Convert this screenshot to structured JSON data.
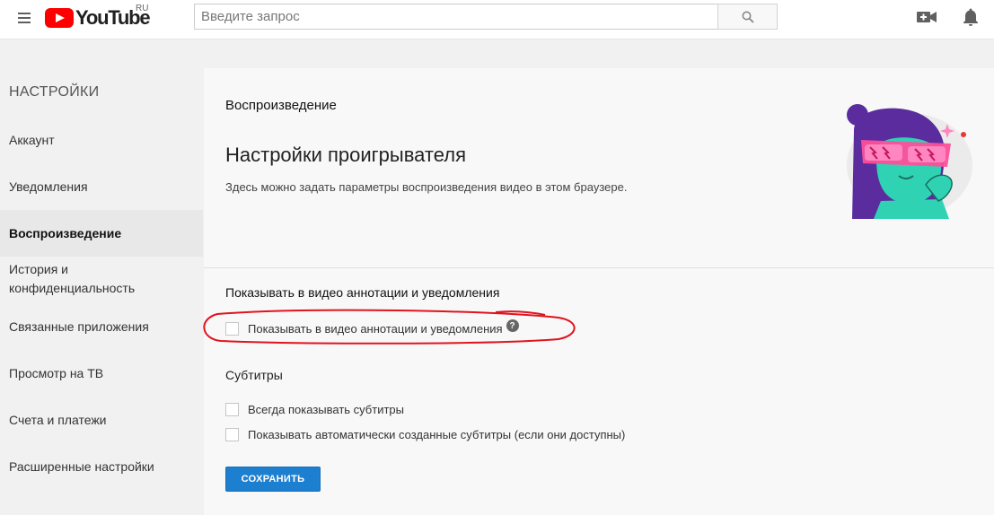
{
  "header": {
    "logo_text": "YouTube",
    "logo_region": "RU",
    "search_placeholder": "Введите запрос"
  },
  "sidebar": {
    "title": "НАСТРОЙКИ",
    "items": [
      {
        "label": "Аккаунт"
      },
      {
        "label": "Уведомления"
      },
      {
        "label": "Воспроизведение"
      },
      {
        "label": "История и конфиденциальность"
      },
      {
        "label": "Связанные приложения"
      },
      {
        "label": "Просмотр на ТВ"
      },
      {
        "label": "Счета и платежи"
      },
      {
        "label": "Расширенные настройки"
      }
    ]
  },
  "main": {
    "section_title": "Воспроизведение",
    "heading": "Настройки проигрывателя",
    "description": "Здесь можно задать параметры воспроизведения видео в этом браузере.",
    "annotations": {
      "heading": "Показывать в видео аннотации и уведомления",
      "checkbox_label": "Показывать в видео аннотации и уведомления",
      "checked": false
    },
    "subtitles": {
      "heading": "Субтитры",
      "options": [
        {
          "label": "Всегда показывать субтитры",
          "checked": false
        },
        {
          "label": "Показывать автоматически созданные субтитры (если они доступны)",
          "checked": false
        }
      ]
    },
    "save_label": "СОХРАНИТЬ"
  },
  "colors": {
    "brand_red": "#ff0000",
    "save_blue": "#1d7fcf",
    "annotation_red": "#e0141e"
  }
}
